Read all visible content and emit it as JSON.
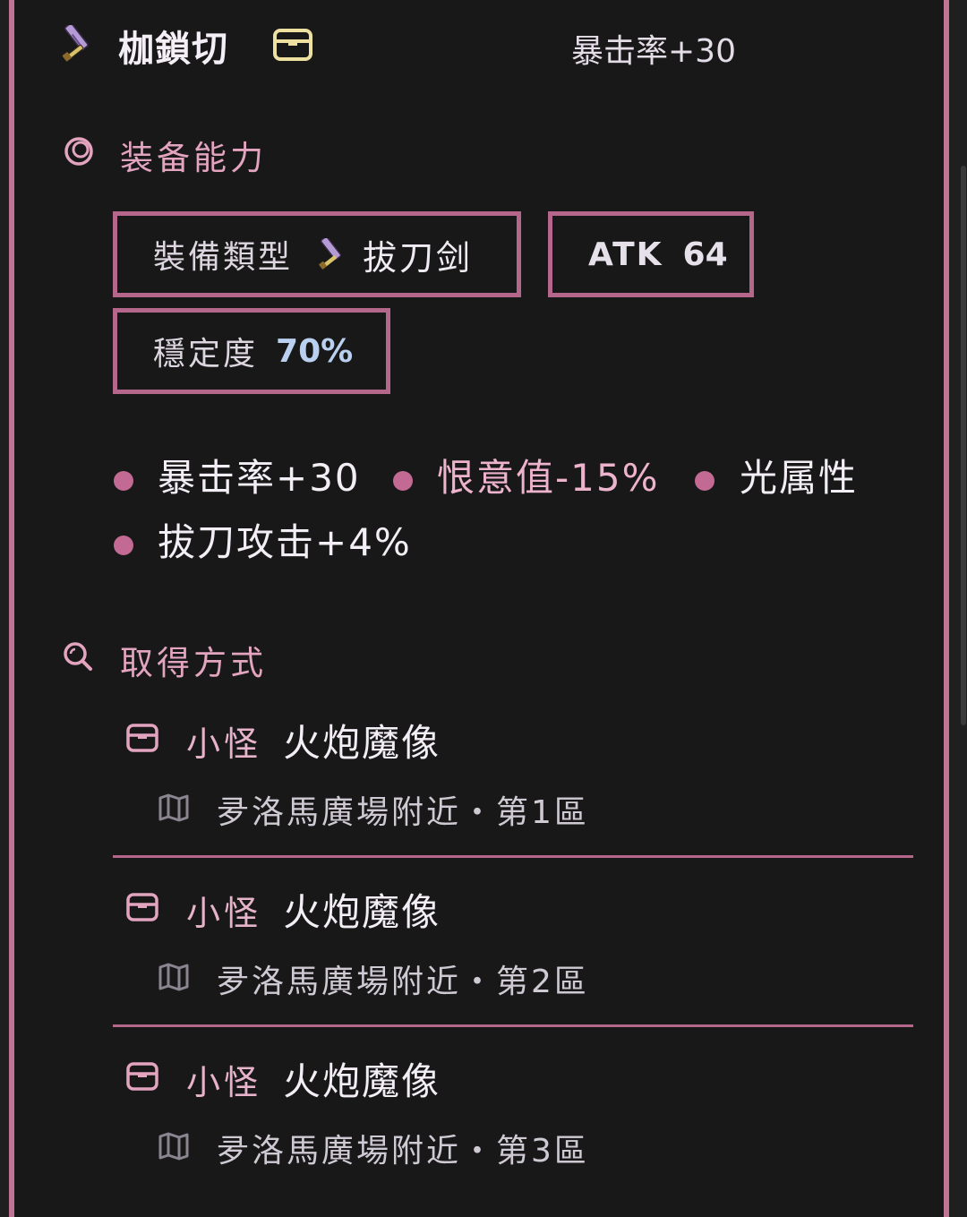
{
  "item": {
    "name": "枷鎖切",
    "top_stat": "暴击率+30"
  },
  "ability_section": {
    "title": "装备能力",
    "type_label": "裝備類型",
    "type_value": "拔刀剑",
    "atk_label": "ATK",
    "atk_value": "64",
    "stability_label": "穩定度",
    "stability_value": "70%",
    "attributes": [
      "暴击率+30",
      "恨意值-15%",
      "光属性",
      "拔刀攻击+4%"
    ]
  },
  "source_section": {
    "title": "取得方式",
    "sources": [
      {
        "kind": "小怪",
        "name": "火炮魔像",
        "location": "夛洛馬廣場附近・第1區"
      },
      {
        "kind": "小怪",
        "name": "火炮魔像",
        "location": "夛洛馬廣場附近・第2區"
      },
      {
        "kind": "小怪",
        "name": "火炮魔像",
        "location": "夛洛馬廣場附近・第3區"
      }
    ]
  },
  "colors": {
    "accent": "#c07395",
    "section_title": "#e3a4bf",
    "highlight": "#eeb3cc",
    "stability_blue": "#b9d0f0",
    "background": "#181818"
  },
  "icons": [
    "sword-icon",
    "chest-icon",
    "swirl-icon",
    "search-icon",
    "map-icon"
  ]
}
